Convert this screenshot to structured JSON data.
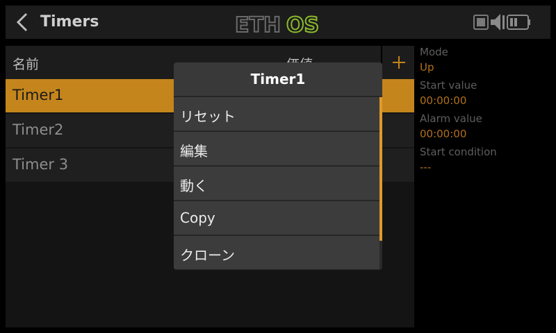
{
  "header": {
    "title": "Timers",
    "logo": {
      "left": "ETH",
      "right": "OS"
    }
  },
  "list": {
    "columns": {
      "name": "名前",
      "value": "価値"
    },
    "rows": [
      {
        "label": "Timer1",
        "selected": true
      },
      {
        "label": "Timer2",
        "selected": false
      },
      {
        "label": "Timer 3",
        "selected": false
      }
    ]
  },
  "info": {
    "mode_label": "Mode",
    "mode_value": "Up",
    "start_value_label": "Start value",
    "start_value": "00:00:00",
    "alarm_value_label": "Alarm value",
    "alarm_value": "00:00:00",
    "start_condition_label": "Start condition",
    "start_condition_value": "---"
  },
  "menu": {
    "title": "Timer1",
    "items": [
      "リセット",
      "編集",
      "動く",
      "Copy",
      "クローン"
    ]
  },
  "colors": {
    "accent": "#c4851c",
    "logo_green": "#8dbb2c",
    "logo_gray": "#6a6a6a"
  },
  "icons": [
    "back-icon",
    "add-icon",
    "sd-card-icon",
    "speaker-icon",
    "battery-icon"
  ]
}
